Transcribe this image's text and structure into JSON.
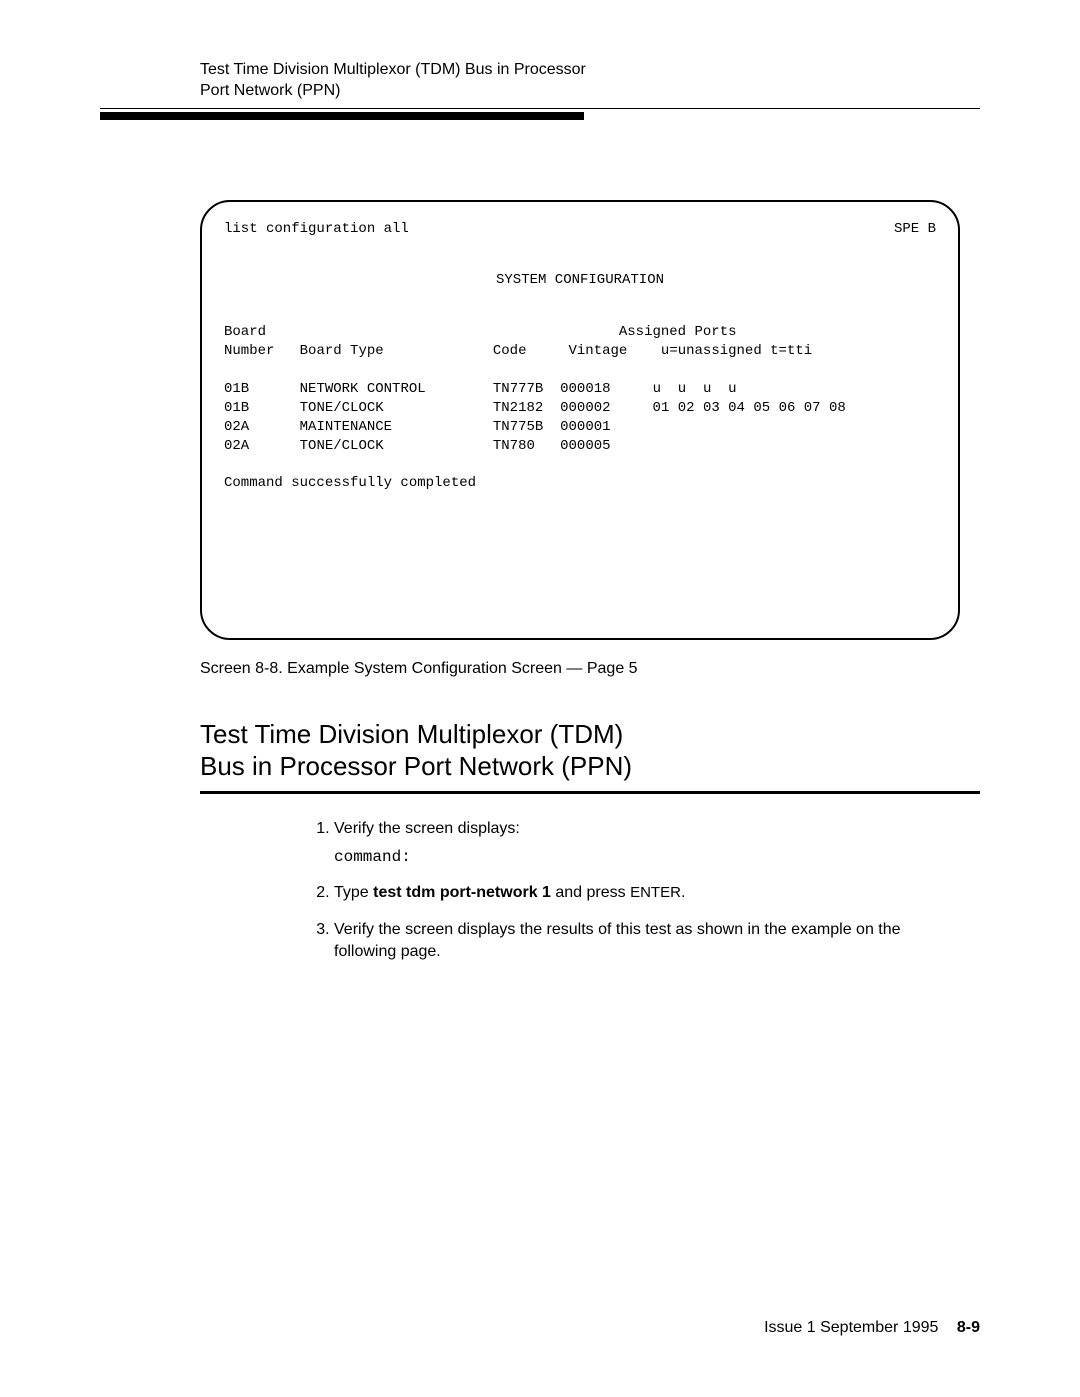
{
  "running_header": {
    "line1": "Test Time Division Multiplexor (TDM) Bus in Processor",
    "line2": "Port Network (PPN)"
  },
  "terminal": {
    "cmd": "list configuration all",
    "spe": "SPE B",
    "title": "SYSTEM CONFIGURATION",
    "hdr": {
      "board": "Board",
      "number": "Number",
      "type": "Board Type",
      "code": "Code",
      "vintage": "Vintage",
      "assigned": "Assigned Ports",
      "legend": "u=unassigned t=tti"
    },
    "rows": [
      {
        "num": "01B",
        "type": "NETWORK CONTROL",
        "code": "TN777B",
        "vintage": "000018",
        "ports": "u  u  u  u"
      },
      {
        "num": "01B",
        "type": "TONE/CLOCK",
        "code": "TN2182",
        "vintage": "000002",
        "ports": "01 02 03 04 05 06 07 08"
      },
      {
        "num": "02A",
        "type": "MAINTENANCE",
        "code": "TN775B",
        "vintage": "000001",
        "ports": ""
      },
      {
        "num": "02A",
        "type": "TONE/CLOCK",
        "code": "TN780",
        "vintage": "000005",
        "ports": ""
      }
    ],
    "status": "Command successfully completed"
  },
  "caption": "Screen 8-8.   Example System Configuration Screen — Page 5",
  "section": {
    "line1": "Test Time Division Multiplexor (TDM)",
    "line2": "Bus in Processor Port Network (PPN)"
  },
  "steps": {
    "s1": "Verify the screen displays:",
    "s1_mono": "command:",
    "s2_a": "Type ",
    "s2_b": "test tdm port-network 1",
    "s2_c": " and press ",
    "s2_d": "ENTER",
    "s2_e": ".",
    "s3": "Verify the screen displays the results of this test as shown in the example on the following page."
  },
  "footer": {
    "issue": "Issue 1  September 1995",
    "page": "8-9"
  }
}
